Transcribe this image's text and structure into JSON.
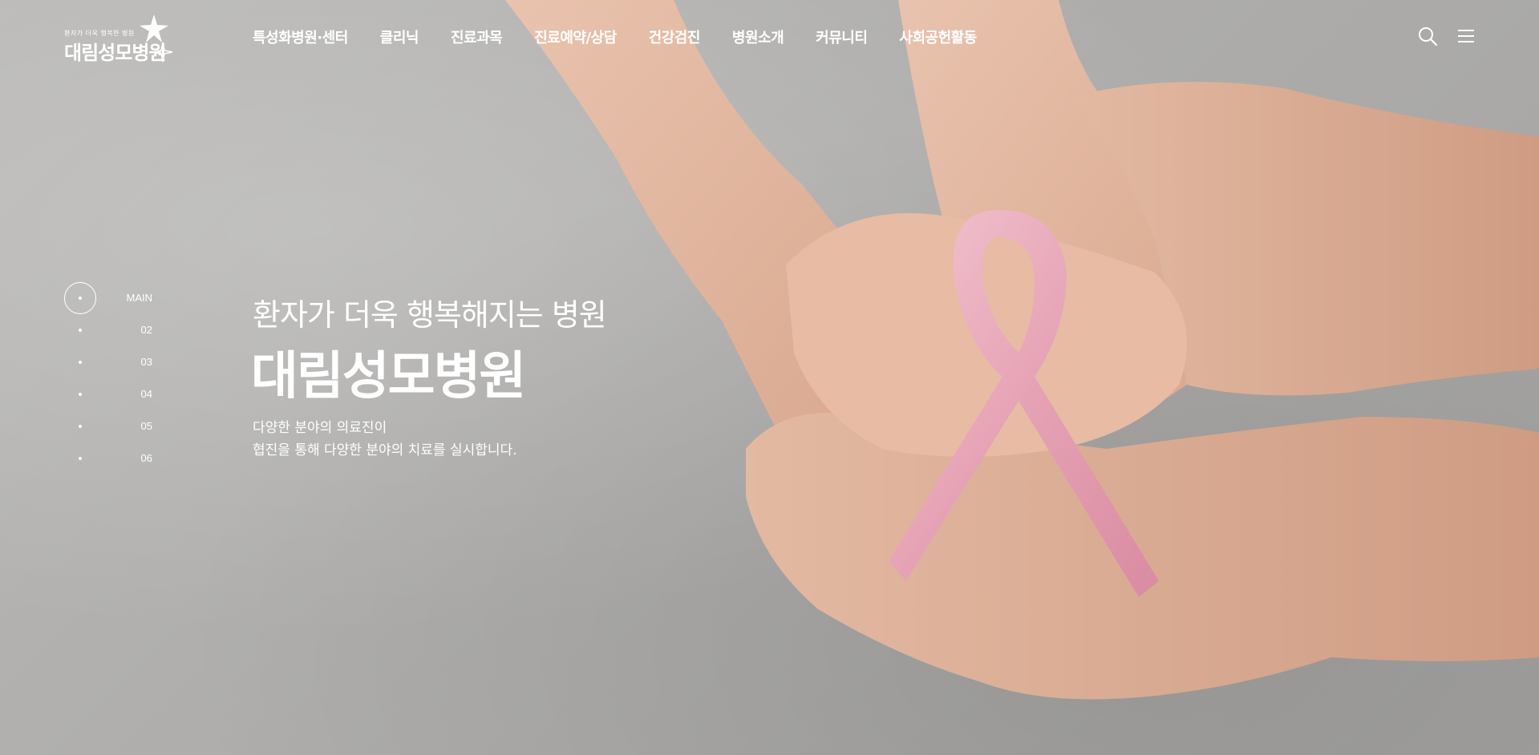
{
  "header": {
    "logo": {
      "tagline": "환자가 더욱 행복한 병원",
      "name": "대림성모병원"
    },
    "nav": [
      "특성화병원·센터",
      "클리닉",
      "진료과목",
      "진료예약/상담",
      "건강검진",
      "병원소개",
      "커뮤니티",
      "사회공헌활동"
    ],
    "icons": {
      "search": "search-icon",
      "menu": "hamburger-menu-icon"
    }
  },
  "pager": {
    "items": [
      "MAIN",
      "02",
      "03",
      "04",
      "05",
      "06"
    ],
    "active_index": 0
  },
  "hero": {
    "subtitle": "환자가 더욱 행복해지는 병원",
    "title": "대림성모병원",
    "description": [
      "다양한 분야의 의료진이",
      "협진을 통해 다양한 분야의 치료를 실시합니다."
    ]
  },
  "colors": {
    "text": "#ffffff",
    "background": "#b0afad",
    "ribbon": "#e6a4b8"
  }
}
